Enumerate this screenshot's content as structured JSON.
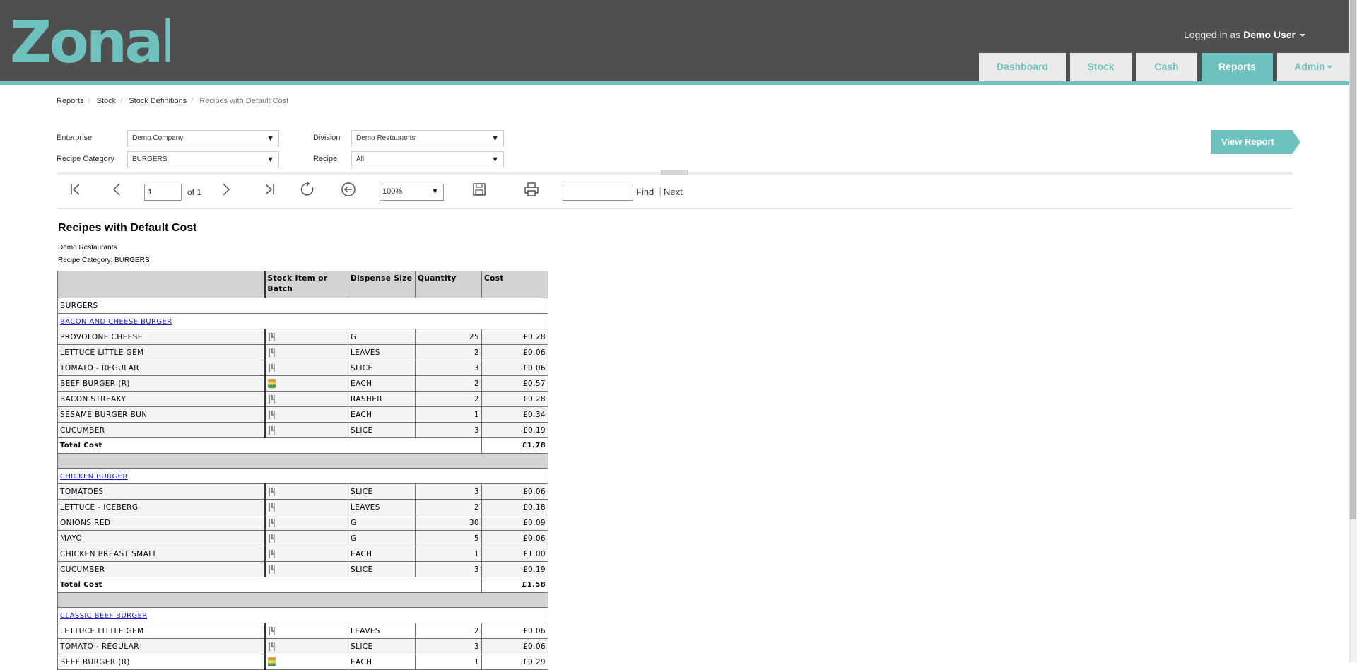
{
  "header": {
    "logo_text": "Zonal",
    "logged_in_prefix": "Logged in as",
    "user_name": "Demo User",
    "tabs": [
      {
        "label": "Dashboard",
        "active": false
      },
      {
        "label": "Stock",
        "active": false
      },
      {
        "label": "Cash",
        "active": false
      },
      {
        "label": "Reports",
        "active": true
      },
      {
        "label": "Admin",
        "active": false
      }
    ]
  },
  "breadcrumb": [
    "Reports",
    "Stock",
    "Stock Definitions",
    "Recipes with Default Cost"
  ],
  "filters": {
    "enterprise_label": "Enterprise",
    "enterprise_value": "Demo Company",
    "division_label": "Division",
    "division_value": "Demo Restaurants",
    "recipe_category_label": "Recipe Category",
    "recipe_category_value": "BURGERS",
    "recipe_label": "Recipe",
    "recipe_value": "All",
    "view_report_label": "View Report"
  },
  "toolbar": {
    "page_value": "1",
    "of_label": "of 1",
    "zoom_value": "100%",
    "find_label": "Find",
    "separator": "|",
    "next_label": "Next"
  },
  "report": {
    "title": "Recipes with Default Cost",
    "division": "Demo Restaurants",
    "category_line": "Recipe Category: BURGERS",
    "columns": [
      "",
      "Stock Item or Batch",
      "Dispense Size",
      "Quantity",
      "Cost"
    ],
    "category": "BURGERS",
    "total_label": "Total Cost",
    "recipes": [
      {
        "name": "BACON AND CHEESE BURGER",
        "items": [
          {
            "name": "PROVOLONE CHEESE",
            "type": "stock",
            "size": "G",
            "qty": "25",
            "cost": "£0.28"
          },
          {
            "name": "LETTUCE LITTLE GEM",
            "type": "stock",
            "size": "LEAVES",
            "qty": "2",
            "cost": "£0.06"
          },
          {
            "name": "TOMATO - REGULAR",
            "type": "stock",
            "size": "SLICE",
            "qty": "3",
            "cost": "£0.06"
          },
          {
            "name": "BEEF BURGER (R)",
            "type": "batch",
            "size": "EACH",
            "qty": "2",
            "cost": "£0.57"
          },
          {
            "name": "BACON STREAKY",
            "type": "stock",
            "size": "RASHER",
            "qty": "2",
            "cost": "£0.28"
          },
          {
            "name": "SESAME BURGER BUN",
            "type": "stock",
            "size": "EACH",
            "qty": "1",
            "cost": "£0.34"
          },
          {
            "name": "CUCUMBER",
            "type": "stock",
            "size": "SLICE",
            "qty": "3",
            "cost": "£0.19"
          }
        ],
        "total": "£1.78"
      },
      {
        "name": "CHICKEN BURGER",
        "items": [
          {
            "name": "TOMATOES",
            "type": "stock",
            "size": "SLICE",
            "qty": "3",
            "cost": "£0.06"
          },
          {
            "name": "LETTUCE - ICEBERG",
            "type": "stock",
            "size": "LEAVES",
            "qty": "2",
            "cost": "£0.18"
          },
          {
            "name": "ONIONS RED",
            "type": "stock",
            "size": "G",
            "qty": "30",
            "cost": "£0.09"
          },
          {
            "name": "MAYO",
            "type": "stock",
            "size": "G",
            "qty": "5",
            "cost": "£0.06"
          },
          {
            "name": "CHICKEN BREAST SMALL",
            "type": "stock",
            "size": "EACH",
            "qty": "1",
            "cost": "£1.00"
          },
          {
            "name": "CUCUMBER",
            "type": "stock",
            "size": "SLICE",
            "qty": "3",
            "cost": "£0.19"
          }
        ],
        "total": "£1.58"
      },
      {
        "name": "CLASSIC BEEF BURGER",
        "items": [
          {
            "name": "LETTUCE LITTLE GEM",
            "type": "stock",
            "size": "LEAVES",
            "qty": "2",
            "cost": "£0.06"
          },
          {
            "name": "TOMATO - REGULAR",
            "type": "stock",
            "size": "SLICE",
            "qty": "3",
            "cost": "£0.06"
          },
          {
            "name": "BEEF BURGER (R)",
            "type": "batch",
            "size": "EACH",
            "qty": "1",
            "cost": "£0.29"
          }
        ],
        "total": null
      }
    ]
  },
  "colors": {
    "header_bg": "#4f4f4f",
    "accent": "#6ec1bd",
    "link": "#1a1acd"
  }
}
